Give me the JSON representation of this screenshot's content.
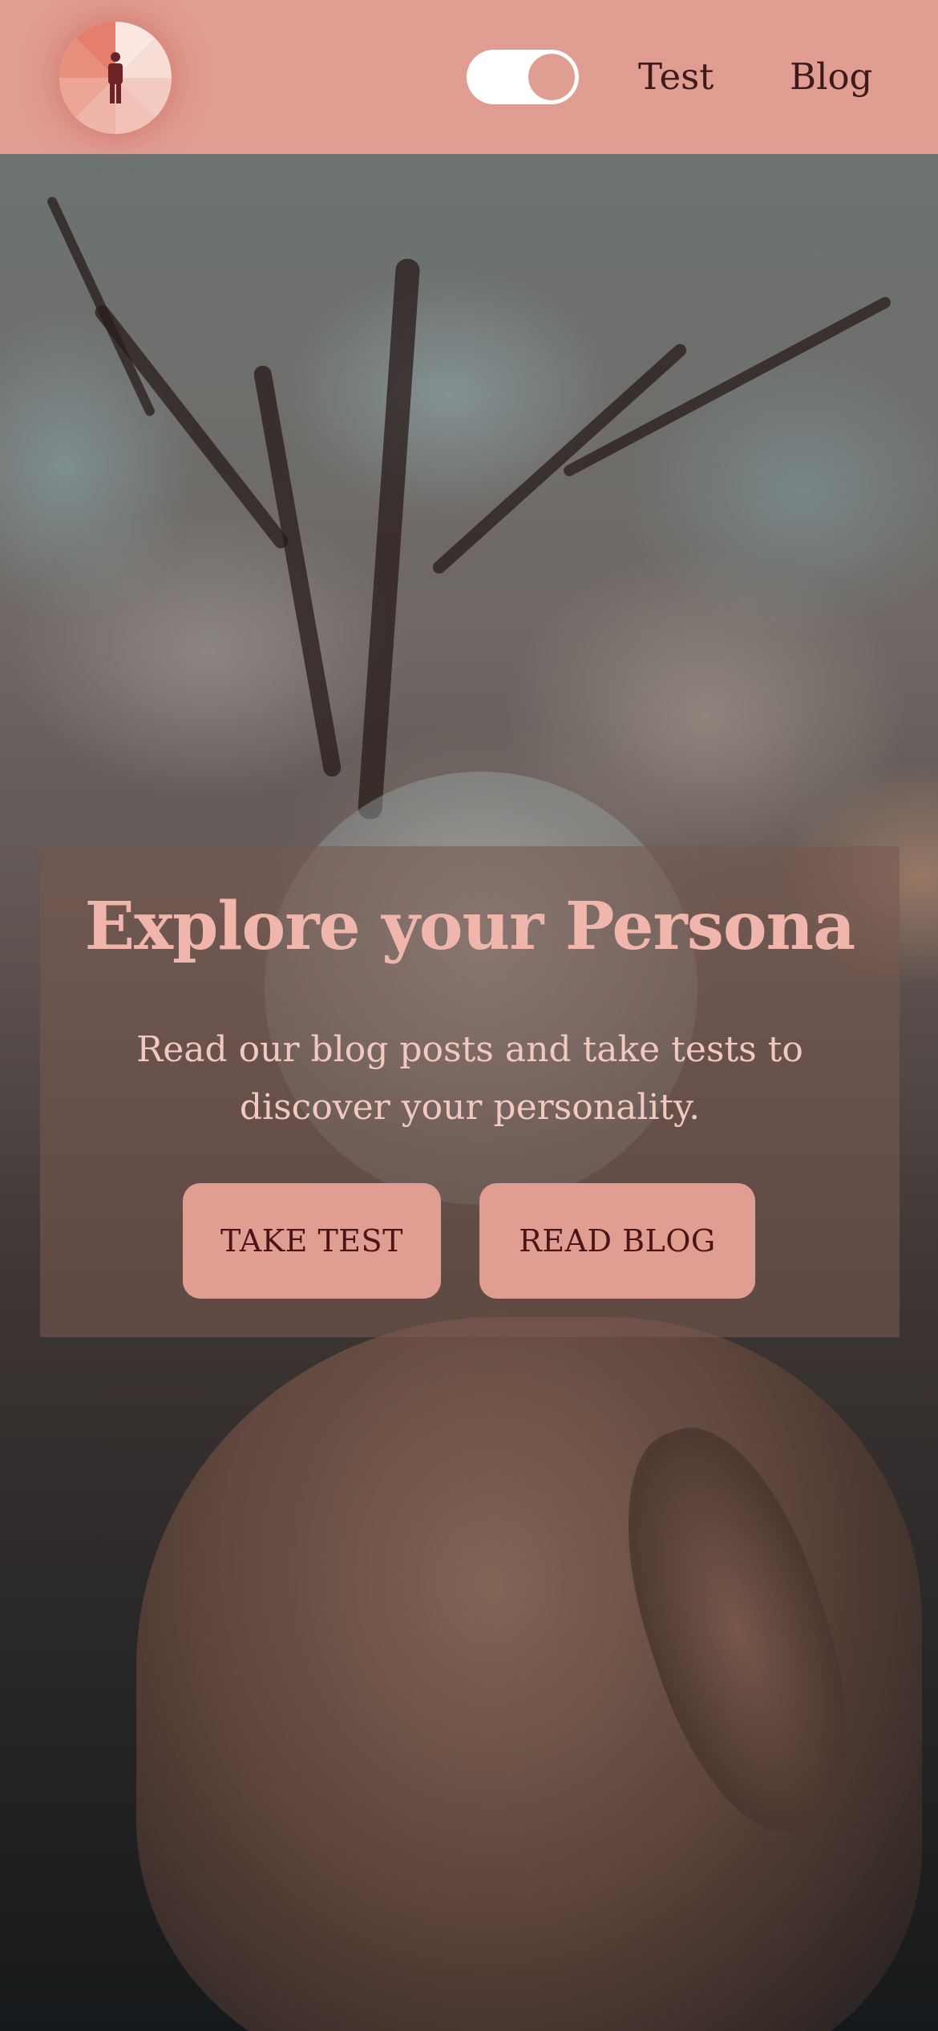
{
  "header": {
    "logo_icon": "person-wheel-logo-icon",
    "theme_toggle": {
      "state": "on",
      "icon": "toggle-switch-icon"
    },
    "nav": [
      {
        "label": "Test"
      },
      {
        "label": "Blog"
      }
    ]
  },
  "hero": {
    "background_image": "crystal-ball-in-hand-under-trees",
    "title": "Explore your Persona",
    "subtitle": "Read our blog posts and take tests to discover your personality.",
    "buttons": {
      "take_test": "TAKE TEST",
      "read_blog": "READ BLOG"
    }
  },
  "colors": {
    "brand_salmon": "#e09d92",
    "title_pink": "#f1b6ab",
    "button_text": "#4a1518",
    "nav_text": "#3e1a1a"
  }
}
